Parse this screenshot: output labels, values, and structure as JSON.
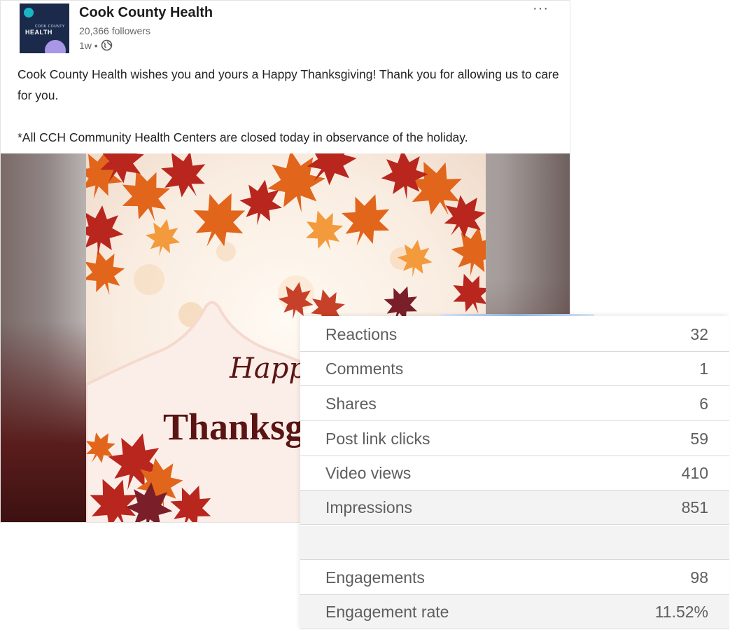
{
  "post": {
    "org_name": "Cook County Health",
    "followers": "20,366 followers",
    "age": "1w •",
    "logo": {
      "small_text": "COOK COUNTY",
      "main_text": "HEALTH"
    },
    "text_line1": "Cook County Health wishes you and yours a Happy Thanksgiving! Thank you for allowing us to care for you.",
    "text_line2": "*All CCH Community Health Centers are closed today in observance of the holiday.",
    "more_label": "···",
    "image": {
      "greeting_script": "Happy",
      "greeting_main": "Thanksgiving"
    }
  },
  "stats": {
    "rows": [
      {
        "label": "Reactions",
        "value": "32"
      },
      {
        "label": "Comments",
        "value": "1"
      },
      {
        "label": "Shares",
        "value": "6"
      },
      {
        "label": "Post link clicks",
        "value": "59"
      },
      {
        "label": "Video views",
        "value": "410"
      },
      {
        "label": "Impressions",
        "value": "851"
      },
      {
        "label": "",
        "value": ""
      },
      {
        "label": "Engagements",
        "value": "98"
      },
      {
        "label": "Engagement rate",
        "value": "11.52%"
      }
    ]
  },
  "colors": {
    "brand_navy": "#1b2a4a",
    "leaf_orange": "#e2651c",
    "leaf_red": "#b8261e",
    "title_maroon": "#5a1414"
  }
}
